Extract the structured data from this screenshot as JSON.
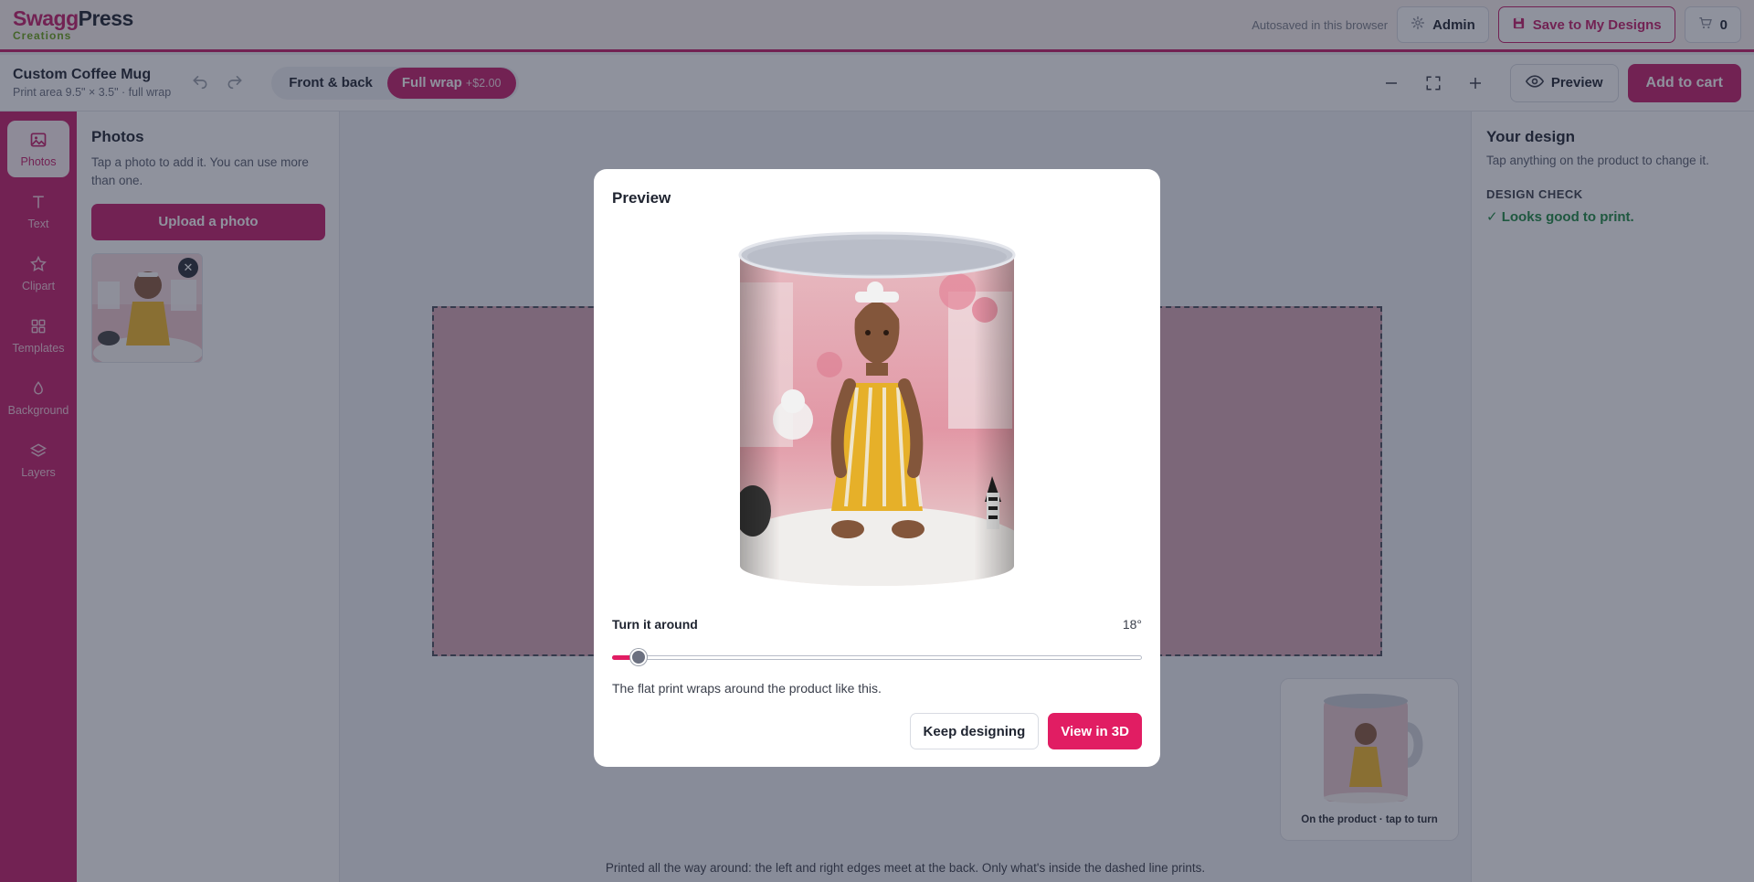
{
  "brand": {
    "name_part1": "Swagg",
    "name_part2": "Press",
    "tagline": "Creations"
  },
  "header": {
    "autosave": "Autosaved in this browser",
    "admin_label": "Admin",
    "save_label": "Save to My Designs",
    "cart_count": "0"
  },
  "product": {
    "title": "Custom Coffee Mug",
    "subtitle": "Print area 9.5\" × 3.5\" · full wrap"
  },
  "modes": {
    "option1": "Front & back",
    "option2": "Full wrap",
    "option2_price": "+$2.00",
    "active": "Full wrap"
  },
  "toolbar": {
    "preview_label": "Preview",
    "add_to_cart": "Add to cart"
  },
  "rail": {
    "items": [
      {
        "label": "Photos",
        "icon": "image-icon"
      },
      {
        "label": "Text",
        "icon": "text-icon"
      },
      {
        "label": "Clipart",
        "icon": "star-icon"
      },
      {
        "label": "Templates",
        "icon": "grid-icon"
      },
      {
        "label": "Background",
        "icon": "drop-icon"
      },
      {
        "label": "Layers",
        "icon": "layers-icon"
      }
    ]
  },
  "photos_panel": {
    "title": "Photos",
    "description": "Tap a photo to add it. You can use more than one.",
    "upload_label": "Upload a photo"
  },
  "canvas": {
    "note": "Printed all the way around: the left and right edges meet at the back. Only what's inside the dashed line prints.",
    "mini_caption": "On the product · tap to turn"
  },
  "design_panel": {
    "title": "Your design",
    "description": "Tap anything on the product to change it.",
    "check_title": "DESIGN CHECK",
    "check_result": "✓ Looks good to print."
  },
  "modal": {
    "title": "Preview",
    "rotate_label": "Turn it around",
    "rotate_value": "18°",
    "rotate_fraction": 0.05,
    "note": "The flat print wraps around the product like this.",
    "keep_label": "Keep designing",
    "view3d_label": "View in 3D"
  },
  "colors": {
    "brand": "#c41f6b",
    "accent": "#e11d63",
    "ok": "#1f8a44"
  }
}
